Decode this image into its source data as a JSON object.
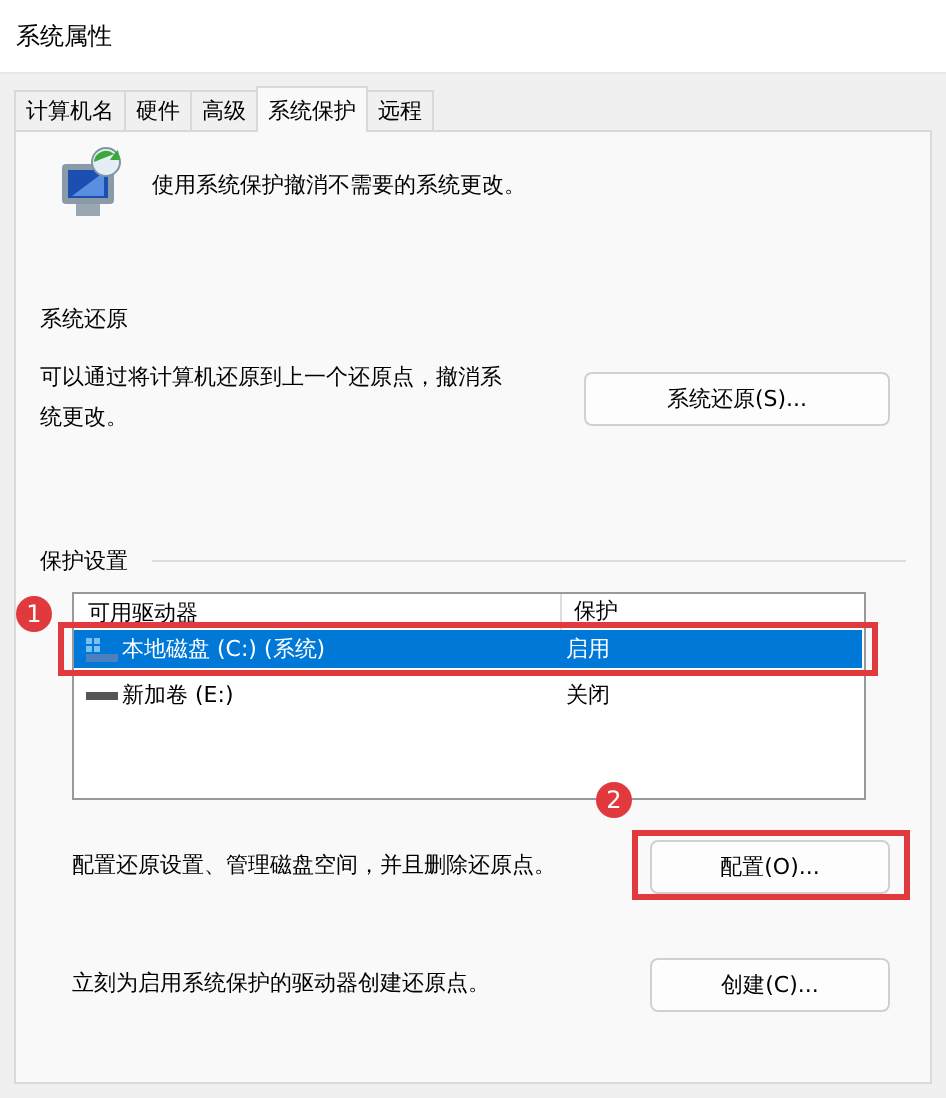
{
  "window": {
    "title": "系统属性"
  },
  "tabs": [
    {
      "label": "计算机名",
      "selected": false
    },
    {
      "label": "硬件",
      "selected": false
    },
    {
      "label": "高级",
      "selected": false
    },
    {
      "label": "系统保护",
      "selected": true
    },
    {
      "label": "远程",
      "selected": false
    }
  ],
  "intro": {
    "text": "使用系统保护撤消不需要的系统更改。"
  },
  "restore": {
    "heading": "系统还原",
    "text": "可以通过将计算机还原到上一个还原点，撤消系统更改。",
    "button": "系统还原(S)..."
  },
  "protection": {
    "heading": "保护设置",
    "columns": [
      "可用驱动器",
      "保护"
    ],
    "callout": "1",
    "drives": [
      {
        "kind": "system",
        "name": "本地磁盘 (C:) (系统)",
        "status": "启用",
        "selected": true
      },
      {
        "kind": "data",
        "name": "新加卷 (E:)",
        "status": "关闭",
        "selected": false
      }
    ],
    "configure": {
      "text": "配置还原设置、管理磁盘空间，并且删除还原点。",
      "button": "配置(O)...",
      "callout": "2"
    },
    "create": {
      "text": "立刻为启用系统保护的驱动器创建还原点。",
      "button": "创建(C)..."
    }
  }
}
